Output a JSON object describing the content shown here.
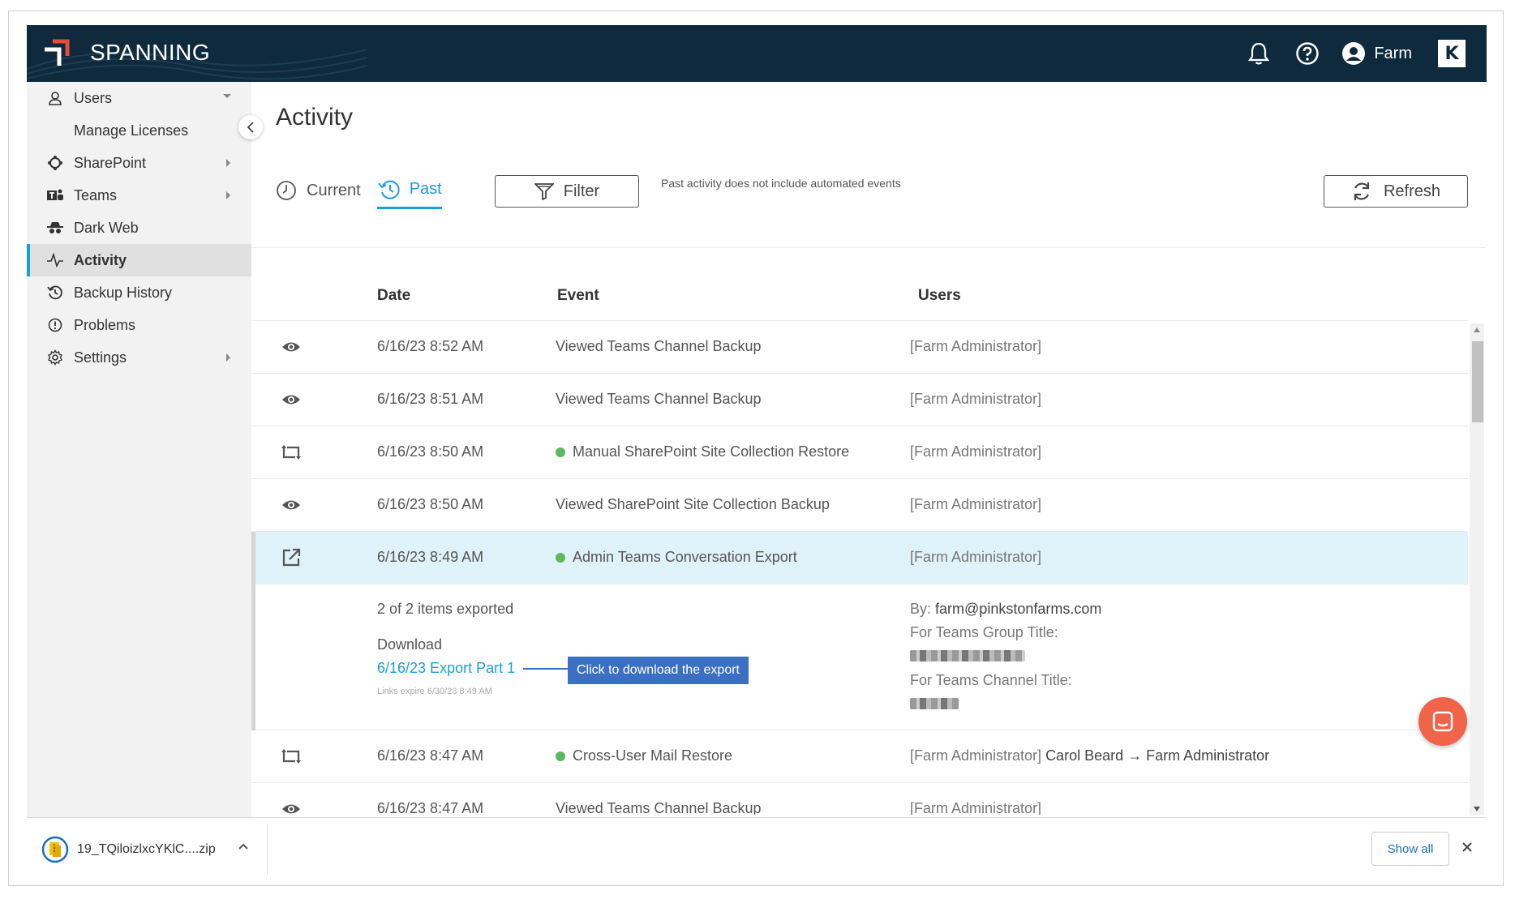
{
  "header": {
    "brand": "SPANNING",
    "user_name": "Farm",
    "badge_letter": "K",
    "colors": {
      "bg": "#0f2a3c",
      "logo_red": "#e84c3d"
    }
  },
  "sidebar": {
    "items": [
      {
        "label": "Users",
        "icon": "user-icon"
      },
      {
        "label": "Manage Licenses"
      },
      {
        "label": "SharePoint",
        "icon": "sharepoint-icon"
      },
      {
        "label": "Teams",
        "icon": "teams-icon"
      },
      {
        "label": "Dark Web",
        "icon": "spy-icon"
      },
      {
        "label": "Activity",
        "icon": "activity-icon"
      },
      {
        "label": "Backup History",
        "icon": "history-icon"
      },
      {
        "label": "Problems",
        "icon": "alert-icon"
      },
      {
        "label": "Settings",
        "icon": "gear-icon"
      }
    ]
  },
  "main": {
    "title": "Activity",
    "tabs": [
      {
        "label": "Current"
      },
      {
        "label": "Past"
      }
    ],
    "filter_label": "Filter",
    "note": "Past activity does not include automated events",
    "refresh_label": "Refresh",
    "columns": {
      "date": "Date",
      "event": "Event",
      "users": "Users"
    },
    "rows": [
      {
        "icon": "eye-icon",
        "date": "6/16/23 8:52 AM",
        "event": "Viewed Teams Channel Backup",
        "users": "[Farm Administrator]"
      },
      {
        "icon": "eye-icon",
        "date": "6/16/23 8:51 AM",
        "event": "Viewed Teams Channel Backup",
        "users": "[Farm Administrator]"
      },
      {
        "icon": "restore-icon",
        "date": "6/16/23 8:50 AM",
        "event": "Manual SharePoint Site Collection Restore",
        "users": "[Farm Administrator]"
      },
      {
        "icon": "eye-icon",
        "date": "6/16/23 8:50 AM",
        "event": "Viewed SharePoint Site Collection Backup",
        "users": "[Farm Administrator]"
      },
      {
        "icon": "export-icon",
        "date": "6/16/23 8:49 AM",
        "event": "Admin Teams Conversation Export",
        "users": "[Farm Administrator]"
      },
      {
        "icon": "restore-icon",
        "date": "6/16/23 8:47 AM",
        "event": "Cross-User Mail Restore",
        "users": "[Farm Administrator]",
        "users_rest": "Carol Beard → Farm Administrator"
      },
      {
        "icon": "eye-icon",
        "date": "6/16/23 8:47 AM",
        "event": "Viewed Teams Channel Backup",
        "users": "[Farm Administrator]"
      }
    ],
    "detail": {
      "items_exported": "2 of 2 items exported",
      "download_label": "Download",
      "link_label": "6/16/23 Export Part 1",
      "expires": "Links expire 6/30/23 8:49 AM",
      "tooltip": "Click to download the export",
      "by_label": "By:",
      "by_value": "farm@pinkstonfarms.com",
      "group_title_label": "For Teams Group Title:",
      "channel_title_label": "For Teams Channel Title:"
    }
  },
  "download_bar": {
    "filename": "19_TQiloizlxcYKlC....zip",
    "show_all": "Show all"
  }
}
